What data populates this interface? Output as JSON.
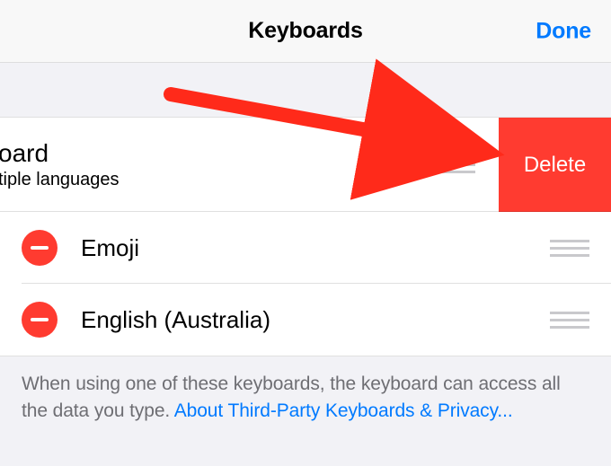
{
  "nav": {
    "title": "Keyboards",
    "done": "Done"
  },
  "rows": {
    "swiped": {
      "title_frag": "oard",
      "subtitle_frag": "tiple languages",
      "delete": "Delete"
    },
    "r2": {
      "label": "Emoji"
    },
    "r3": {
      "label": "English (Australia)"
    }
  },
  "footer": {
    "text": "When using one of these keyboards, the keyboard can access all the data you type. ",
    "link": "About Third-Party Keyboards & Privacy..."
  }
}
